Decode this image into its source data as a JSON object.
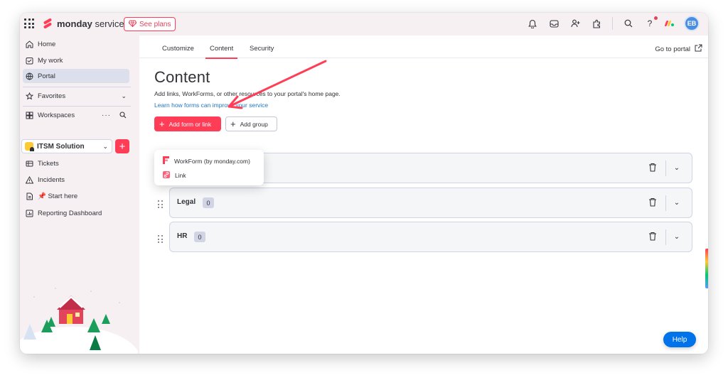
{
  "app": {
    "brand_bold": "monday",
    "brand_rest": " service",
    "see_plans": "See plans",
    "avatar_initials": "EB",
    "accent_color": "#ff3d57",
    "link_color": "#1f76c2"
  },
  "topbar_icons": [
    "bell-icon",
    "inbox-icon",
    "invite-members-icon",
    "apps-icon",
    "search-icon",
    "help-icon",
    "monday-logo-icon"
  ],
  "sidebar": {
    "items": [
      {
        "label": "Home",
        "icon": "home-icon"
      },
      {
        "label": "My work",
        "icon": "my-work-icon"
      },
      {
        "label": "Portal",
        "icon": "portal-icon"
      }
    ],
    "favorites": "Favorites",
    "workspaces": "Workspaces",
    "workspace_name": "ITSM Solution",
    "boards": [
      {
        "label": "Tickets",
        "icon": "board-icon"
      },
      {
        "label": "Incidents",
        "icon": "warning-icon"
      },
      {
        "label": "📌 Start here",
        "icon": "doc-icon"
      },
      {
        "label": "Reporting Dashboard",
        "icon": "dashboard-icon"
      }
    ]
  },
  "main": {
    "tabs": [
      "Customize",
      "Content",
      "Security"
    ],
    "goto_portal": "Go to portal",
    "title": "Content",
    "description": "Add links, WorkForms, or other resources to your portal's home page.",
    "learn_link": "Learn how forms can improve your service",
    "add_form_button": "Add form or link",
    "add_group_button": "Add group",
    "dropdown": [
      {
        "label": "WorkForm (by monday.com)",
        "icon": "workform-icon"
      },
      {
        "label": "Link",
        "icon": "link-icon"
      }
    ],
    "groups": [
      {
        "name": "",
        "count": ""
      },
      {
        "name": "Legal",
        "count": "0"
      },
      {
        "name": "HR",
        "count": "0"
      }
    ],
    "help": "Help"
  }
}
